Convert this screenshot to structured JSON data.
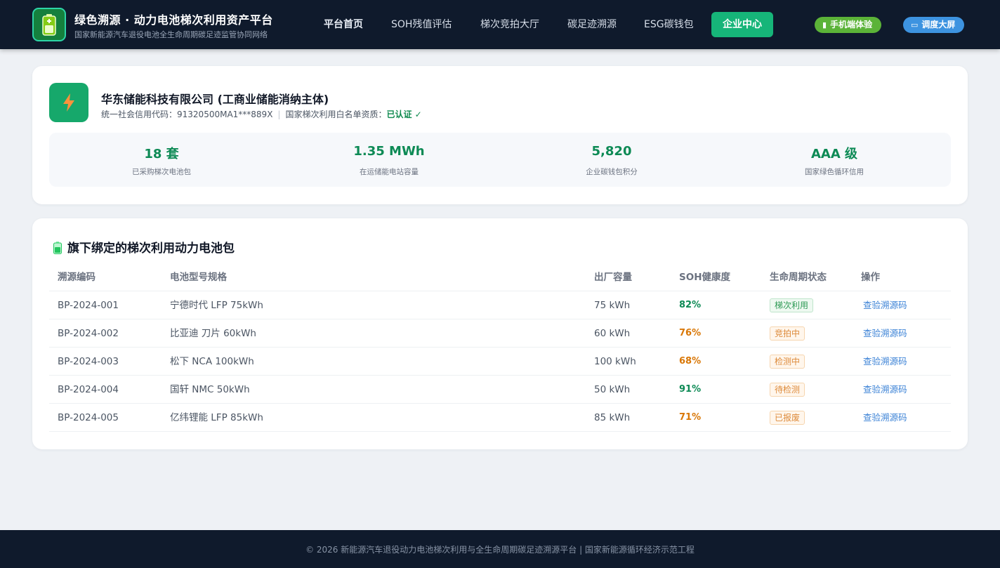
{
  "header": {
    "brand_title": "绿色溯源 · 动力电池梯次利用资产平台",
    "brand_subtitle": "国家新能源汽车退役电池全生命周期碳足迹监管协同网络",
    "nav": [
      {
        "label": "平台首页"
      },
      {
        "label": "SOH残值评估"
      },
      {
        "label": "梯次竞拍大厅"
      },
      {
        "label": "碳足迹溯源"
      },
      {
        "label": "ESG碳钱包"
      },
      {
        "label": "企业中心"
      }
    ],
    "active_nav": "企业中心",
    "mobile_button": "手机端体验",
    "screen_button": "调度大屏"
  },
  "company": {
    "name": "华东储能科技有限公司 (工商业储能消纳主体)",
    "credit_label": "统一社会信用代码：",
    "credit_code": "91320500MA1***889X",
    "whitelist_label": "国家梯次利用白名单资质：",
    "whitelist_status": "已认证 ✓",
    "stats": [
      {
        "value": "18 套",
        "label": "已采购梯次电池包"
      },
      {
        "value": "1.35 MWh",
        "label": "在运储能电站容量"
      },
      {
        "value": "5,820",
        "label": "企业碳钱包积分"
      },
      {
        "value": "AAA 级",
        "label": "国家绿色循环信用"
      }
    ]
  },
  "packs": {
    "title": "旗下绑定的梯次利用动力电池包",
    "columns": [
      "溯源编码",
      "电池型号规格",
      "出厂容量",
      "SOH健康度",
      "生命周期状态",
      "操作"
    ],
    "rows": [
      {
        "code": "BP-2024-001",
        "model": "宁德时代 LFP 75kWh",
        "capacity": "75 kWh",
        "soh": "82%",
        "status": "梯次利用",
        "action": "查验溯源码"
      },
      {
        "code": "BP-2024-002",
        "model": "比亚迪 刀片 60kWh",
        "capacity": "60 kWh",
        "soh": "76%",
        "status": "竞拍中",
        "action": "查验溯源码"
      },
      {
        "code": "BP-2024-003",
        "model": "松下 NCA 100kWh",
        "capacity": "100 kWh",
        "soh": "68%",
        "status": "检测中",
        "action": "查验溯源码"
      },
      {
        "code": "BP-2024-004",
        "model": "国轩 NMC 50kWh",
        "capacity": "50 kWh",
        "soh": "91%",
        "status": "待检测",
        "action": "查验溯源码"
      },
      {
        "code": "BP-2024-005",
        "model": "亿纬锂能 LFP 85kWh",
        "capacity": "85 kWh",
        "soh": "71%",
        "status": "已报废",
        "action": "查验溯源码"
      }
    ]
  },
  "footer": {
    "text": "© 2026 新能源汽车退役动力电池梯次利用与全生命周期碳足迹溯源平台 | 国家新能源循环经济示范工程"
  },
  "icons": {
    "logo": "battery-icon",
    "company": "lightning-bolt-icon",
    "mobile": "phone-icon",
    "screen": "monitor-icon",
    "section": "battery-icon"
  },
  "colors": {
    "header_bg": "#0f1a2c",
    "accent_green": "#16b579",
    "stat_green": "#0d8a55",
    "soh_warning": "#d97706",
    "link_blue": "#3b82d6"
  }
}
